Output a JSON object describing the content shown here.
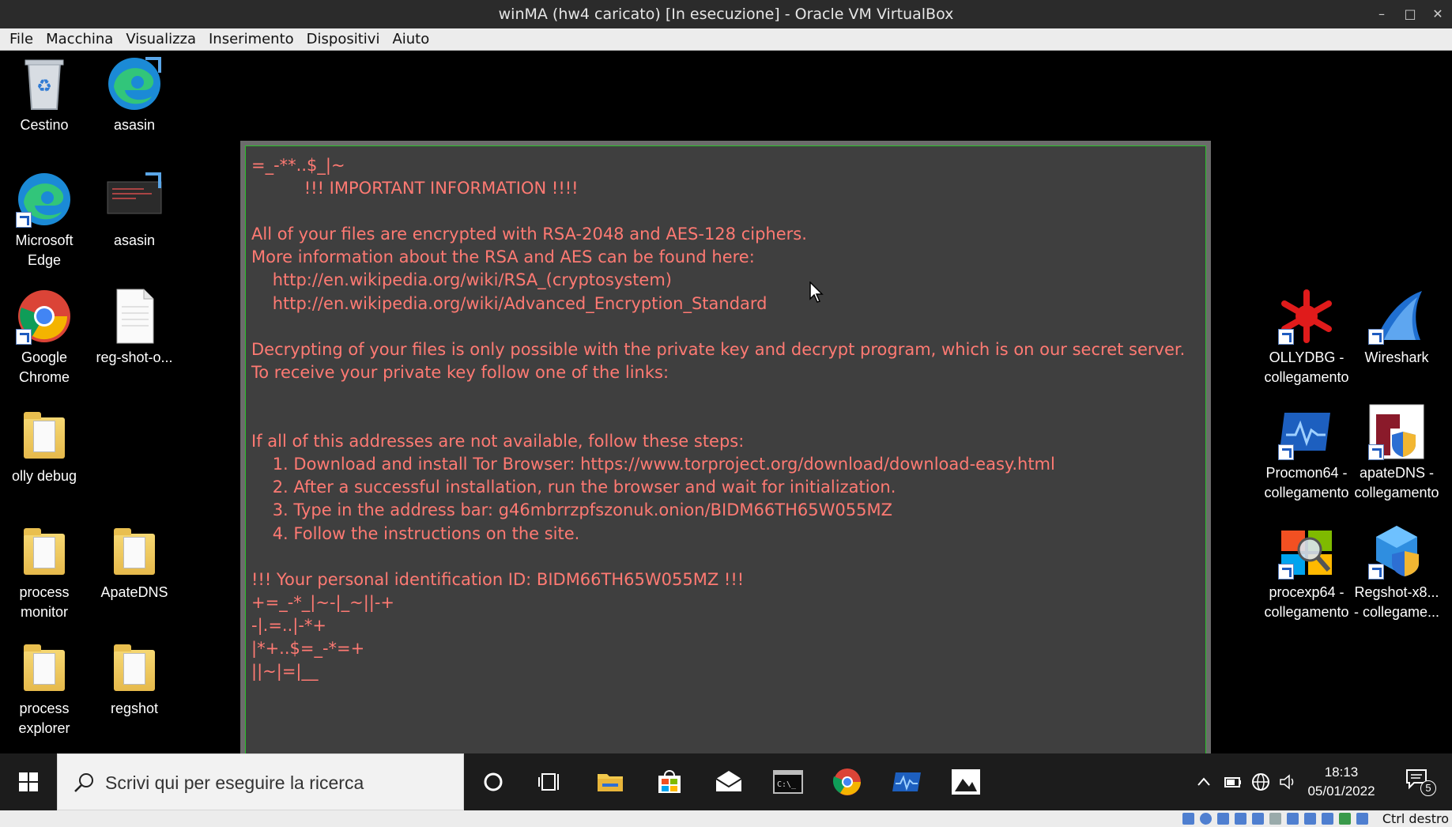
{
  "host": {
    "title": "winMA (hw4 caricato) [In esecuzione] - Oracle VM VirtualBox",
    "menu": [
      "File",
      "Macchina",
      "Visualizza",
      "Inserimento",
      "Dispositivi",
      "Aiuto"
    ],
    "host_key": "Ctrl destro"
  },
  "desktop_icons": {
    "recycle": "Cestino",
    "asasin1": "asasin",
    "edge": "Microsoft Edge",
    "asasin2": "asasin",
    "chrome": "Google Chrome",
    "regshot_file": "reg-shot-o...",
    "olly_debug": "olly debug",
    "process_monitor": "process monitor",
    "apatedns": "ApateDNS",
    "process_explorer": "process explorer",
    "regshot": "regshot",
    "ollydbg_link": "OLLYDBG - collegamento",
    "wireshark": "Wireshark",
    "procmon_link": "Procmon64 - collegamento",
    "apatedns_link": "apateDNS - collegamento",
    "procexp_link": "procexp64 - collegamento",
    "regshot_link": "Regshot-x8... - collegame..."
  },
  "ransom_note": {
    "lines": [
      "=_-**..$_|~",
      "          !!! IMPORTANT INFORMATION !!!!",
      "",
      "All of your files are encrypted with RSA-2048 and AES-128 ciphers.",
      "More information about the RSA and AES can be found here:",
      "    http://en.wikipedia.org/wiki/RSA_(cryptosystem)",
      "    http://en.wikipedia.org/wiki/Advanced_Encryption_Standard",
      "",
      "Decrypting of your files is only possible with the private key and decrypt program, which is on our secret server.",
      "To receive your private key follow one of the links:",
      "",
      "",
      "If all of this addresses are not available, follow these steps:",
      "    1. Download and install Tor Browser: https://www.torproject.org/download/download-easy.html",
      "    2. After a successful installation, run the browser and wait for initialization.",
      "    3. Type in the address bar: g46mbrrzpfszonuk.onion/BIDM66TH65W055MZ",
      "    4. Follow the instructions on the site.",
      "",
      "!!! Your personal identification ID: BIDM66TH65W055MZ !!!",
      "+=_-*_|~-|_~||-+",
      "-|.=..|-*+",
      "|*+..$=_-*=+",
      "||~|=|__"
    ]
  },
  "taskbar": {
    "search_placeholder": "Scrivi qui per eseguire la ricerca",
    "time": "18:13",
    "date": "05/01/2022",
    "notification_count": "5"
  }
}
